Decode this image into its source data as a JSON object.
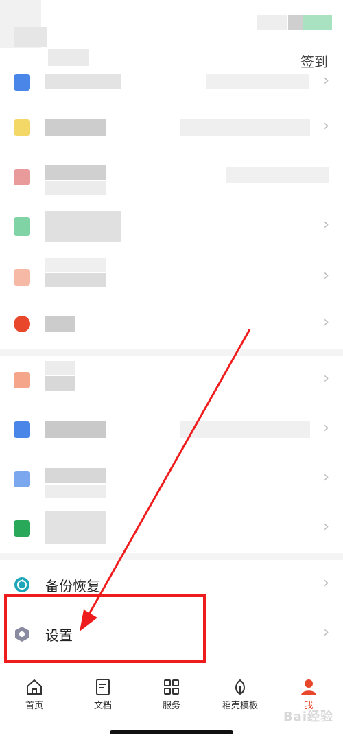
{
  "header": {
    "signin_label": "签到"
  },
  "menu": {
    "backup_label": "备份恢复",
    "settings_label": "设置"
  },
  "tabbar": {
    "items": [
      {
        "label": "首页",
        "icon": "home-icon"
      },
      {
        "label": "文档",
        "icon": "document-icon"
      },
      {
        "label": "服务",
        "icon": "grid-icon"
      },
      {
        "label": "稻壳模板",
        "icon": "leaf-icon"
      },
      {
        "label": "我",
        "icon": "user-icon"
      }
    ]
  },
  "watermark": "Bai经验",
  "colors": {
    "accent": "#e8472c",
    "annotation": "#ee1c1c"
  }
}
